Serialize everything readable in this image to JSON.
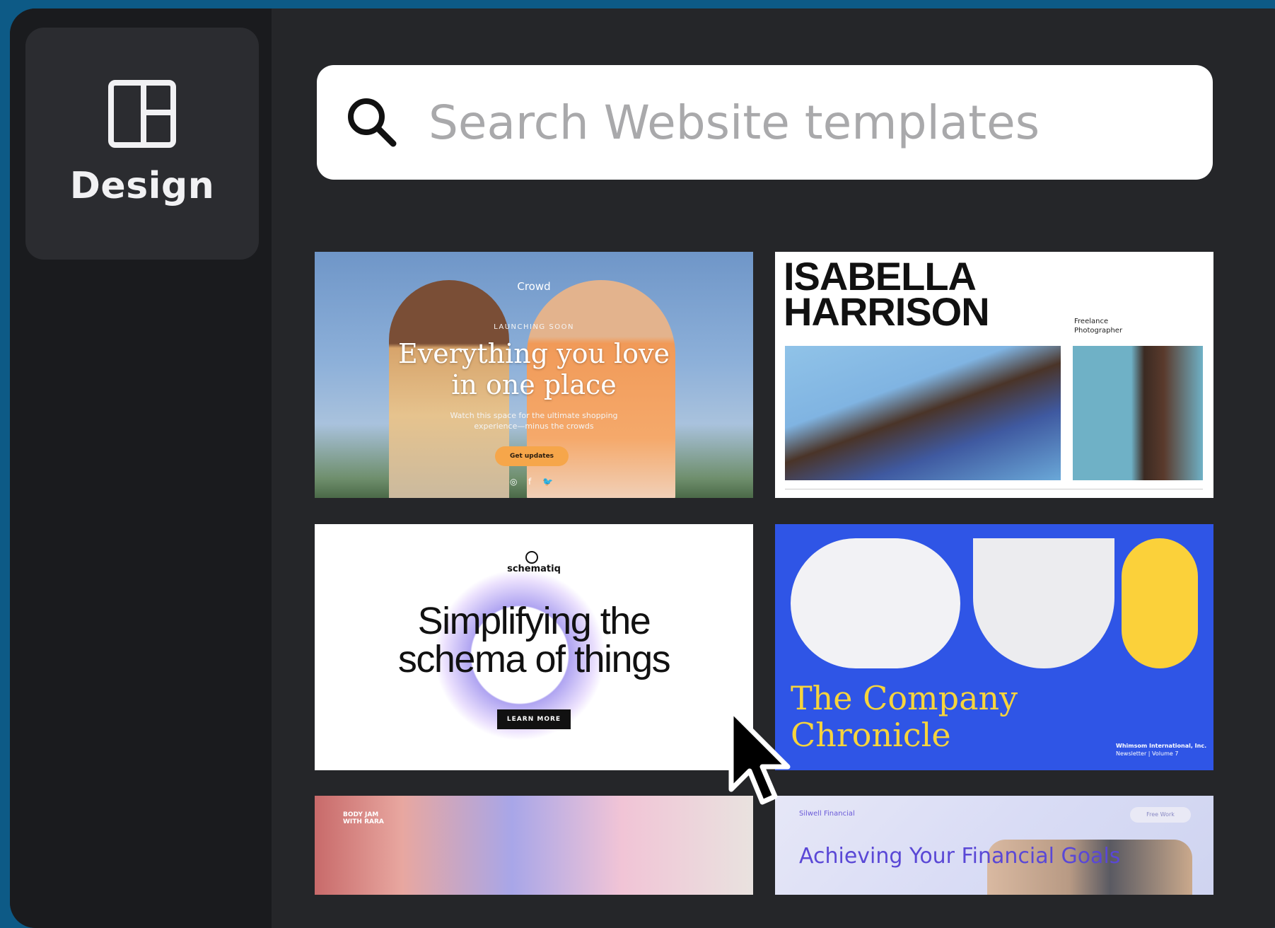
{
  "sidebar": {
    "design_label": "Design"
  },
  "search": {
    "placeholder": "Search Website templates"
  },
  "cards": {
    "crowd": {
      "brand": "Crowd",
      "kicker": "LAUNCHING SOON",
      "headline_line1": "Everything you love",
      "headline_line2": "in one place",
      "subtext": "Watch this space for the ultimate shopping experience—minus the crowds",
      "cta": "Get updates",
      "social": [
        "◎",
        "f",
        "🐦"
      ]
    },
    "isabella": {
      "name_line1": "ISABELLA",
      "name_line2": "HARRISON",
      "role_line1": "Freelance",
      "role_line2": "Photographer"
    },
    "schematiq": {
      "logo": "schematiq",
      "headline_line1": "Simplifying the",
      "headline_line2": "schema of things",
      "cta": "LEARN MORE"
    },
    "chronicle": {
      "title_line1": "The Company",
      "title_line2": "Chronicle",
      "publisher": "Whimsom International, Inc.",
      "issue": "Newsletter | Volume 7"
    },
    "bodyjam": {
      "tag_line1": "BODY JAM",
      "tag_line2": "WITH RARA"
    },
    "silwell": {
      "brand": "Silwell Financial",
      "pill": "Free Work",
      "headline": "Achieving Your Financial Goals"
    }
  },
  "colors": {
    "accent_blue": "#2f55e6",
    "chronicle_yellow": "#f6d43c",
    "crowd_orange": "#f6a64a",
    "background": "#0d5a86"
  }
}
